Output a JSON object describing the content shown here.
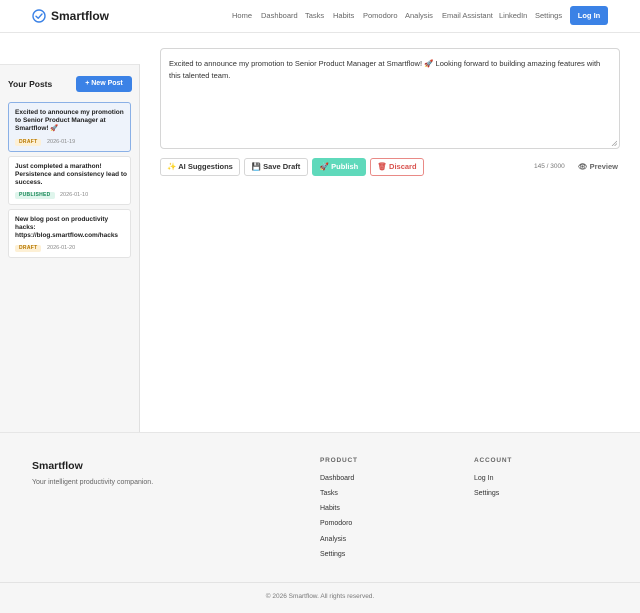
{
  "brand": "Smartflow",
  "colors": {
    "accent": "#3b82e6",
    "publish": "#5fd9bb",
    "discard": "#d9534f"
  },
  "nav": {
    "items": [
      "Home",
      "Dashboard",
      "Tasks",
      "Habits",
      "Pomodoro",
      "Analysis",
      "Email Assistant",
      "LinkedIn",
      "Settings"
    ],
    "login_label": "Log In"
  },
  "sidebar": {
    "title": "Your Posts",
    "new_post_label": "+ New Post",
    "posts": [
      {
        "text": "Excited to announce my promotion to Senior Product Manager at Smartflow! 🚀",
        "status": "DRAFT",
        "date": "2026-01-19"
      },
      {
        "text": "Just completed a marathon! Persistence and consistency lead to success.",
        "status": "PUBLISHED",
        "date": "2026-01-10"
      },
      {
        "text": "New blog post on productivity hacks: https://blog.smartflow.com/hacks",
        "status": "DRAFT",
        "date": "2026-01-20"
      }
    ]
  },
  "editor": {
    "content": "Excited to announce my promotion to Senior Product Manager at Smartflow! 🚀 Looking forward to building amazing features with this talented team.",
    "ai_label": "✨ AI Suggestions",
    "save_label": "💾 Save Draft",
    "publish_label": "🚀 Publish",
    "discard_label": "🗑 Discard",
    "char_count": "145 / 3000",
    "preview_label": "👁 Preview"
  },
  "footer": {
    "brand": "Smartflow",
    "tagline": "Your intelligent productivity companion.",
    "product_heading": "PRODUCT",
    "product_links": [
      "Dashboard",
      "Tasks",
      "Habits",
      "Pomodoro",
      "Analysis",
      "Settings"
    ],
    "account_heading": "ACCOUNT",
    "account_links": [
      "Log In",
      "Settings"
    ],
    "copyright": "© 2026 Smartflow. All rights reserved."
  }
}
